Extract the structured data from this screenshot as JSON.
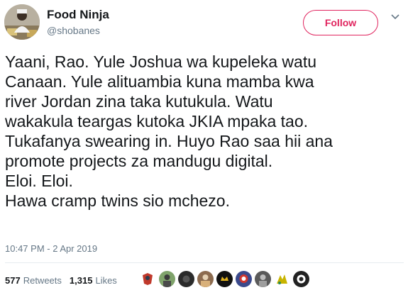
{
  "user": {
    "display_name": "Food Ninja",
    "handle": "@shobanes"
  },
  "follow_button": {
    "label": "Follow"
  },
  "tweet": {
    "lines": [
      "Yaani, Rao. Yule Joshua wa kupeleka watu",
      "Canaan. Yule alituambia kuna mamba kwa",
      "river Jordan zina taka kutukula. Watu",
      "wakakula teargas kutoka JKIA mpaka tao.",
      "Tukafanya swearing in. Huyo Rao saa hii ana",
      "promote projects za mandugu digital.",
      "Eloi. Eloi.",
      "Hawa cramp twins sio mchezo."
    ],
    "timestamp": "10:47 PM - 2 Apr 2019"
  },
  "stats": {
    "retweets_count": "577",
    "retweets_label": "Retweets",
    "likes_count": "1,315",
    "likes_label": "Likes"
  },
  "colors": {
    "accent": "#e0245e",
    "text": "#14171a",
    "secondary": "#657786",
    "divider": "#e6ecf0"
  }
}
